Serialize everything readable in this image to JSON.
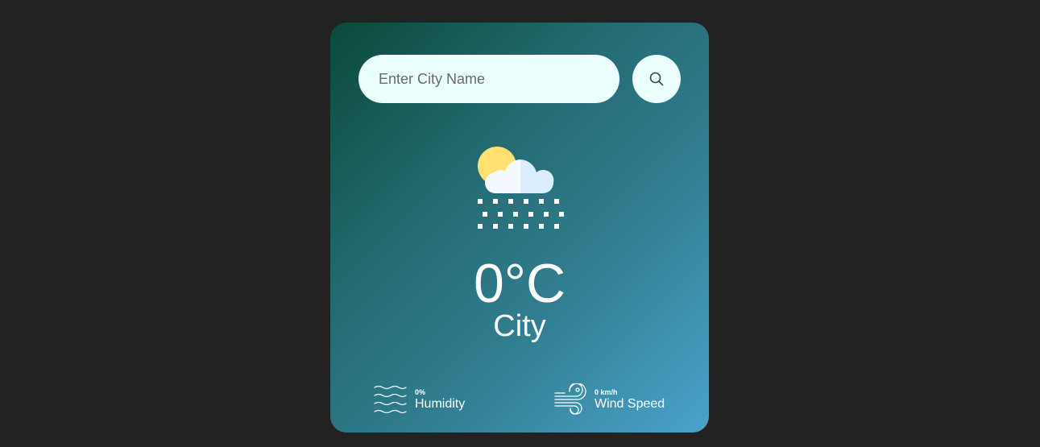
{
  "search": {
    "placeholder": "Enter City Name",
    "value": "",
    "button_icon": "search-icon"
  },
  "weather": {
    "icon": "rain-cloud-sun-icon",
    "temperature": "0°C",
    "city": "City"
  },
  "details": {
    "humidity": {
      "icon": "humidity-waves-icon",
      "value": "0%",
      "label": "Humidity"
    },
    "wind": {
      "icon": "wind-icon",
      "value": "0 km/h",
      "label": "Wind Speed"
    }
  },
  "colors": {
    "page_background": "#222222",
    "card_gradient_start": "#0b4a3a",
    "card_gradient_end": "#4aa3cb",
    "input_background": "#ebfffc",
    "sun": "#ffe070",
    "cloud_light": "#f3f9ff",
    "cloud_shade": "#dbeeff"
  }
}
